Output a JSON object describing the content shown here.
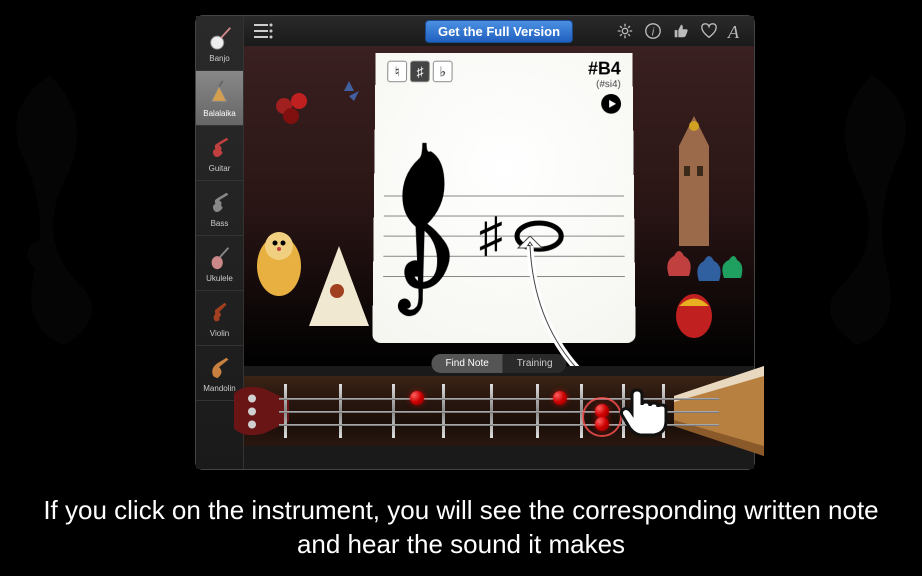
{
  "topbar": {
    "full_version_label": "Get the Full Version"
  },
  "sidebar": {
    "items": [
      {
        "label": "Banjo",
        "selected": false
      },
      {
        "label": "Balalaika",
        "selected": true
      },
      {
        "label": "Guitar",
        "selected": false
      },
      {
        "label": "Bass",
        "selected": false
      },
      {
        "label": "Ukulele",
        "selected": false
      },
      {
        "label": "Violin",
        "selected": false
      },
      {
        "label": "Mandolin",
        "selected": false
      }
    ]
  },
  "accidentals": {
    "natural": "♮",
    "sharp": "♯",
    "flat": "♭"
  },
  "note": {
    "name": "#B4",
    "alt": "(#si4)"
  },
  "modes": {
    "find": "Find Note",
    "training": "Training"
  },
  "caption": "If you click on the instrument, you will see the corresponding written note and hear the sound it makes"
}
